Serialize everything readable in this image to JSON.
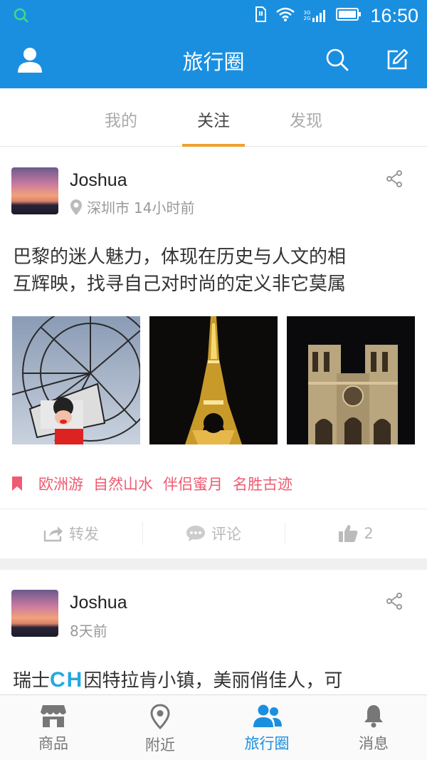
{
  "status_bar": {
    "time": "16:50",
    "network_top": "3G",
    "network_bottom": "2G"
  },
  "app_bar": {
    "title": "旅行圈"
  },
  "tabs": [
    {
      "label": "我的",
      "active": false
    },
    {
      "label": "关注",
      "active": true
    },
    {
      "label": "发现",
      "active": false
    }
  ],
  "posts": [
    {
      "username": "Joshua",
      "location": "深圳市",
      "time": "14小时前",
      "text_line1": "巴黎的迷人魅力，体现在历史与人文的相",
      "text_line2": "互辉映，找寻自己对时尚的定义非它莫属",
      "photos": [
        "ferris-wheel-photo",
        "eiffel-tower-photo",
        "notre-dame-photo"
      ],
      "tags": [
        "欧洲游",
        "自然山水",
        "伴侣蜜月",
        "名胜古迹"
      ],
      "actions": {
        "repost": "转发",
        "comment": "评论",
        "likes": "2"
      }
    },
    {
      "username": "Joshua",
      "time": "8天前",
      "text_prefix": "瑞士",
      "text_logo": "CH",
      "text_suffix": "因特拉肯小镇，美丽俏佳人，可"
    }
  ],
  "bottom_nav": [
    {
      "label": "商品",
      "icon": "store-icon",
      "active": false
    },
    {
      "label": "附近",
      "icon": "location-pin-icon",
      "active": false
    },
    {
      "label": "旅行圈",
      "icon": "people-icon",
      "active": true
    },
    {
      "label": "消息",
      "icon": "bell-icon",
      "active": false
    }
  ],
  "colors": {
    "primary": "#1a8fe0",
    "tag": "#ef5b72",
    "tab_underline": "#f0a030"
  }
}
